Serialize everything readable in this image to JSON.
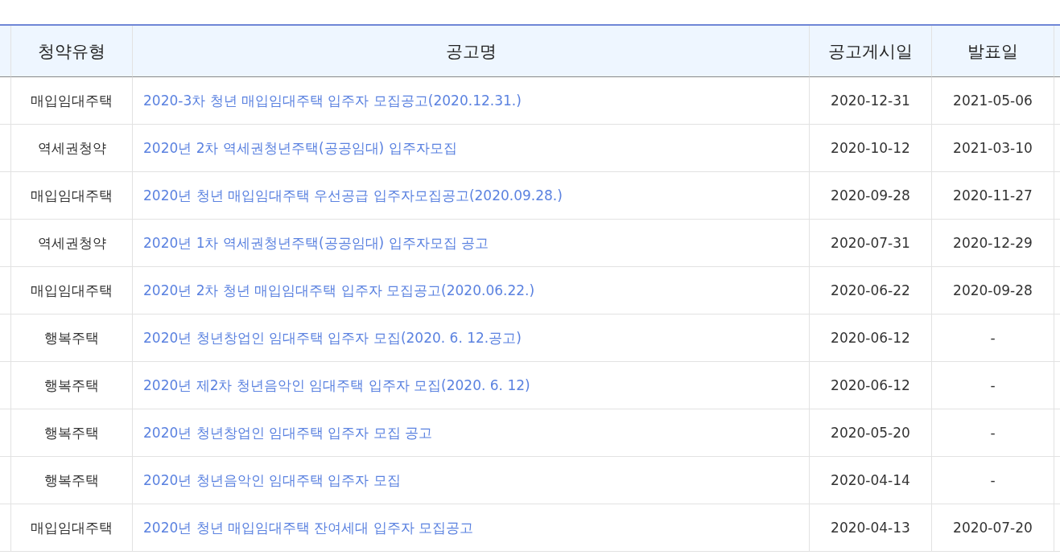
{
  "table": {
    "columns": [
      "청약유형",
      "공고명",
      "공고게시일",
      "발표일"
    ],
    "rows": [
      {
        "type": "매입임대주택",
        "title": "2020-3차 청년 매입임대주택 입주자 모집공고(2020.12.31.)",
        "posted": "2020-12-31",
        "announced": "2021-05-06"
      },
      {
        "type": "역세권청약",
        "title": "2020년 2차 역세권청년주택(공공임대) 입주자모집",
        "posted": "2020-10-12",
        "announced": "2021-03-10"
      },
      {
        "type": "매입임대주택",
        "title": "2020년 청년 매입임대주택 우선공급 입주자모집공고(2020.09.28.)",
        "posted": "2020-09-28",
        "announced": "2020-11-27"
      },
      {
        "type": "역세권청약",
        "title": "2020년 1차 역세권청년주택(공공임대) 입주자모집 공고",
        "posted": "2020-07-31",
        "announced": "2020-12-29"
      },
      {
        "type": "매입임대주택",
        "title": "2020년 2차 청년 매입임대주택 입주자 모집공고(2020.06.22.)",
        "posted": "2020-06-22",
        "announced": "2020-09-28"
      },
      {
        "type": "행복주택",
        "title": "2020년 청년창업인 임대주택 입주자 모집(2020. 6. 12.공고)",
        "posted": "2020-06-12",
        "announced": "-"
      },
      {
        "type": "행복주택",
        "title": "2020년 제2차 청년음악인 임대주택 입주자 모집(2020. 6. 12)",
        "posted": "2020-06-12",
        "announced": "-"
      },
      {
        "type": "행복주택",
        "title": "2020년 청년창업인 임대주택 입주자 모집 공고",
        "posted": "2020-05-20",
        "announced": "-"
      },
      {
        "type": "행복주택",
        "title": "2020년 청년음악인 임대주택 입주자 모집",
        "posted": "2020-04-14",
        "announced": "-"
      },
      {
        "type": "매입임대주택",
        "title": "2020년 청년 매입임대주택 잔여세대 입주자 모집공고",
        "posted": "2020-04-13",
        "announced": "2020-07-20"
      }
    ]
  }
}
